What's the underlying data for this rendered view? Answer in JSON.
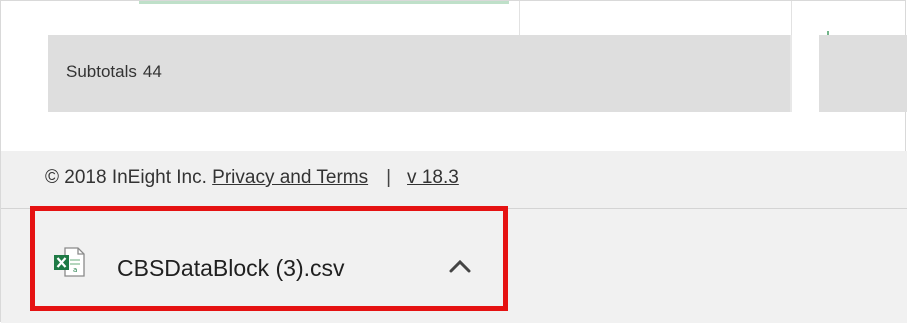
{
  "subtotals": {
    "label": "Subtotals",
    "value": "44"
  },
  "footer": {
    "copyright": "© 2018 InEight Inc.",
    "privacy_link": "Privacy and Terms",
    "separator": "|",
    "version": "v 18.3"
  },
  "download": {
    "filename": "CBSDataBlock (3).csv",
    "file_icon": "excel-file-icon",
    "options_icon": "chevron-up-icon",
    "highlight_color": "#e51212"
  }
}
